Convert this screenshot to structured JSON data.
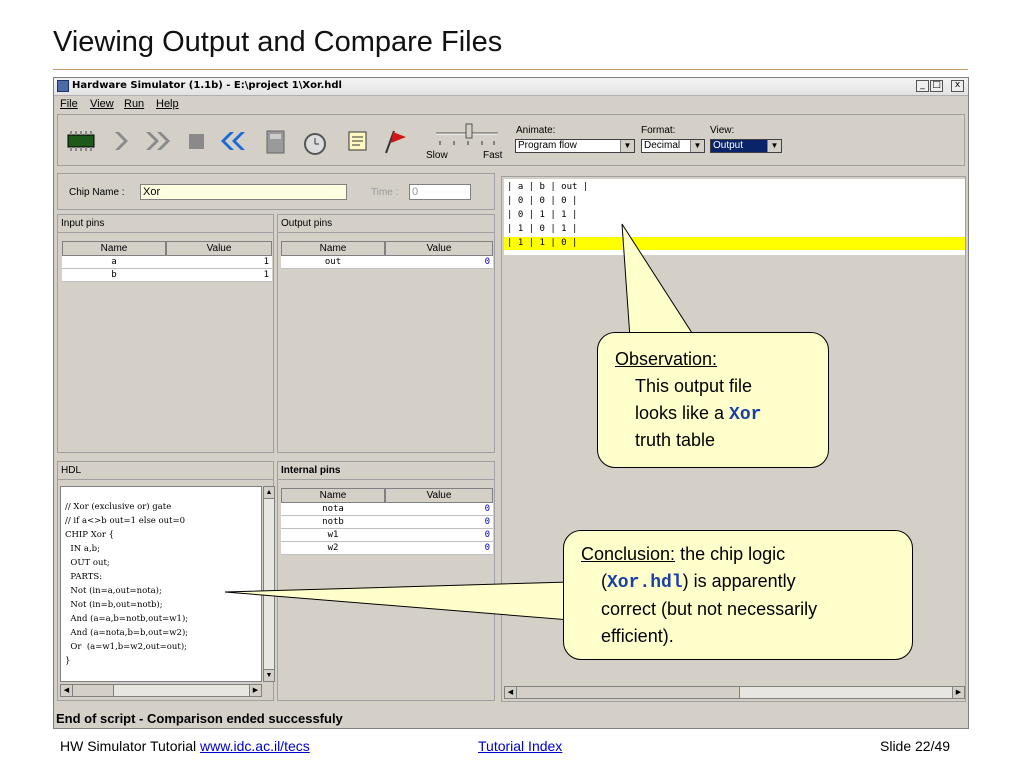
{
  "slide": {
    "title": "Viewing Output and Compare Files"
  },
  "window": {
    "title": "Hardware Simulator (1.1b) - E:\\project 1\\Xor.hdl",
    "buttons": [
      "_",
      "□",
      "x"
    ]
  },
  "menu": [
    "File",
    "View",
    "Run",
    "Help"
  ],
  "toolbar": {
    "slider_slow": "Slow",
    "slider_fast": "Fast",
    "animate_label": "Animate:",
    "animate_value": "Program flow",
    "format_label": "Format:",
    "format_value": "Decimal",
    "view_label": "View:",
    "view_value": "Output"
  },
  "chip": {
    "name_label": "Chip Name :",
    "name_value": "Xor",
    "time_label": "Time :",
    "time_value": "0"
  },
  "input_pins": {
    "title": "Input pins",
    "headers": [
      "Name",
      "Value"
    ],
    "rows": [
      {
        "name": "a",
        "value": "1"
      },
      {
        "name": "b",
        "value": "1"
      }
    ]
  },
  "output_pins": {
    "title": "Output pins",
    "headers": [
      "Name",
      "Value"
    ],
    "rows": [
      {
        "name": "out",
        "value": "0"
      }
    ]
  },
  "hdl": {
    "title": "HDL",
    "lines": [
      "// Xor (exclusive or) gate",
      "// if a<>b out=1 else out=0",
      "CHIP Xor {",
      "  IN a,b;",
      "  OUT out;",
      "  PARTS:",
      "  Not (in=a,out=nota);",
      "  Not (in=b,out=notb);",
      "  And (a=a,b=notb,out=w1);",
      "  And (a=nota,b=b,out=w2);",
      "  Or  (a=w1,b=w2,out=out);",
      "}"
    ]
  },
  "internal_pins": {
    "title": "Internal pins",
    "headers": [
      "Name",
      "Value"
    ],
    "rows": [
      {
        "name": "nota",
        "value": "0"
      },
      {
        "name": "notb",
        "value": "0"
      },
      {
        "name": "w1",
        "value": "0"
      },
      {
        "name": "w2",
        "value": "0"
      }
    ]
  },
  "output_file": {
    "lines": [
      "| a | b | out |",
      "| 0 | 0 | 0 |",
      "| 0 | 1 | 1 |",
      "| 1 | 0 | 1 |",
      "| 1 | 1 | 0 |"
    ],
    "highlight_row": 4,
    "highlight_color": "#ffff00"
  },
  "callouts": {
    "observation": {
      "heading": "Observation:",
      "line1": "This output file",
      "line2_pre": "looks like a ",
      "line2_code": "Xor",
      "line3": "truth table"
    },
    "conclusion": {
      "heading": "Conclusion:",
      "heading_rest": " the chip logic",
      "line2_pre": "(",
      "line2_code": "Xor.hdl",
      "line2_post": ") is apparently",
      "line3": "correct (but not necessarily",
      "line4": "efficient)."
    },
    "fill": "#ffffcc"
  },
  "status": "End of script - Comparison ended successfuly",
  "footer": {
    "left_text": "HW Simulator Tutorial",
    "left_link": "www.idc.ac.il/tecs",
    "center_link": "Tutorial Index",
    "right_text": "Slide 22/49"
  }
}
